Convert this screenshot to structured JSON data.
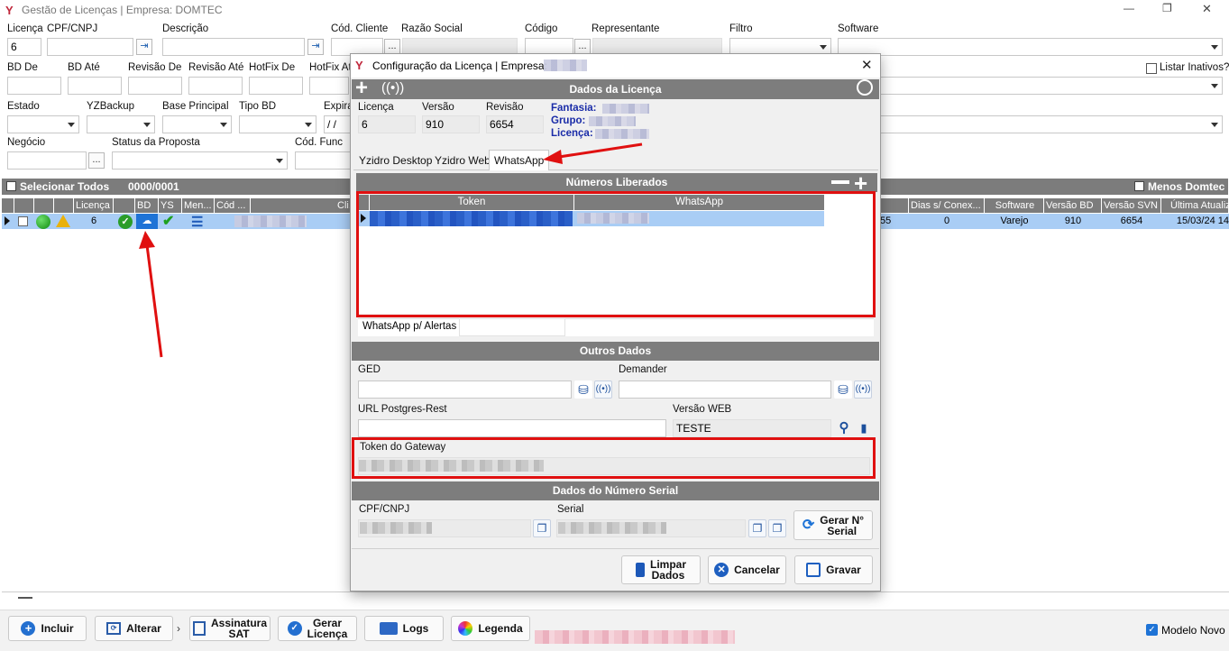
{
  "app": {
    "title": "Gestão de Licenças | Empresa: DOMTEC",
    "win_min": "—",
    "win_max": "❐",
    "win_close": "✕"
  },
  "filters": {
    "licenca_label": "Licença",
    "licenca_value": "6",
    "cpf_label": "CPF/CNPJ",
    "descricao_label": "Descrição",
    "cod_cliente_label": "Cód. Cliente",
    "razao_label": "Razão Social",
    "codigo_label": "Código",
    "representante_label": "Representante",
    "filtro_label": "Filtro",
    "software_label": "Software",
    "bd_de_label": "BD De",
    "bd_ate_label": "BD Até",
    "revisao_de_label": "Revisão De",
    "revisao_ate_label": "Revisão Até",
    "hotfix_de_label": "HotFix De",
    "hotfix_ate_label": "HotFix Até",
    "listar_inativos_label": "Listar Inativos?",
    "estado_label": "Estado",
    "yzbackup_label": "YZBackup",
    "base_principal_label": "Base Principal",
    "tipo_bd_label": "Tipo BD",
    "expira_label": "Expira",
    "expira_value": "/ /",
    "negocio_label": "Negócio",
    "status_proposta_label": "Status da Proposta",
    "cod_func_label": "Cód. Func",
    "ellipsis": "..."
  },
  "grid": {
    "selecionar_todos": "Selecionar Todos",
    "count": "0000/0001",
    "menos_domtec": "Menos Domtec",
    "cols_left": [
      "Licença",
      "BD",
      "YS",
      "Men...",
      "Cód ...",
      "Cli..."
    ],
    "cols_right": [
      "Dias s/ Conex...",
      "Software",
      "Versão BD",
      "Versão SVN",
      "Última Atualiz..."
    ],
    "row": {
      "licenca": "6",
      "col_55": "55",
      "dias": "0",
      "software": "Varejo",
      "versao_bd": "910",
      "versao_svn": "6654",
      "ultima": "15/03/24 14"
    }
  },
  "toolbar": {
    "incluir": "Incluir",
    "alterar": "Alterar",
    "assinatura_1": "Assinatura",
    "assinatura_2": "SAT",
    "gerar_1": "Gerar",
    "gerar_2": "Licença",
    "logs": "Logs",
    "legenda": "Legenda",
    "modelo_novo": "Modelo Novo"
  },
  "dialog": {
    "title": "Configuração da Licença | Empresa:",
    "close": "✕",
    "dados_licenca": "Dados da Licença",
    "licenca_label": "Licença",
    "licenca_value": "6",
    "versao_label": "Versão",
    "versao_value": "910",
    "revisao_label": "Revisão",
    "revisao_value": "6654",
    "fantasia_label": "Fantasia:",
    "grupo_label": "Grupo:",
    "licenca2_label": "Licença:",
    "tabs": [
      "Yzidro Desktop",
      "Yzidro Web",
      "WhatsApp"
    ],
    "numeros_liberados": "Números Liberados",
    "table_headers": [
      "Token",
      "WhatsApp"
    ],
    "whatsapp_alertas": "WhatsApp p/ Alertas",
    "outros_dados": "Outros Dados",
    "ged_label": "GED",
    "demander_label": "Demander",
    "url_label": "URL Postgres-Rest",
    "versao_web_label": "Versão WEB",
    "versao_web_value": "TESTE",
    "token_gateway_label": "Token do Gateway",
    "dados_serial": "Dados do Número Serial",
    "cpf_label": "CPF/CNPJ",
    "serial_label": "Serial",
    "gerar_serial_1": "Gerar N°",
    "gerar_serial_2": "Serial",
    "limpar_1": "Limpar",
    "limpar_2": "Dados",
    "cancelar": "Cancelar",
    "gravar": "Gravar"
  },
  "colors": {
    "accent": "#1e73d6",
    "section_bg": "#7d7d7d",
    "highlight_red": "#e01010",
    "selected_row": "#a9cdf5"
  }
}
